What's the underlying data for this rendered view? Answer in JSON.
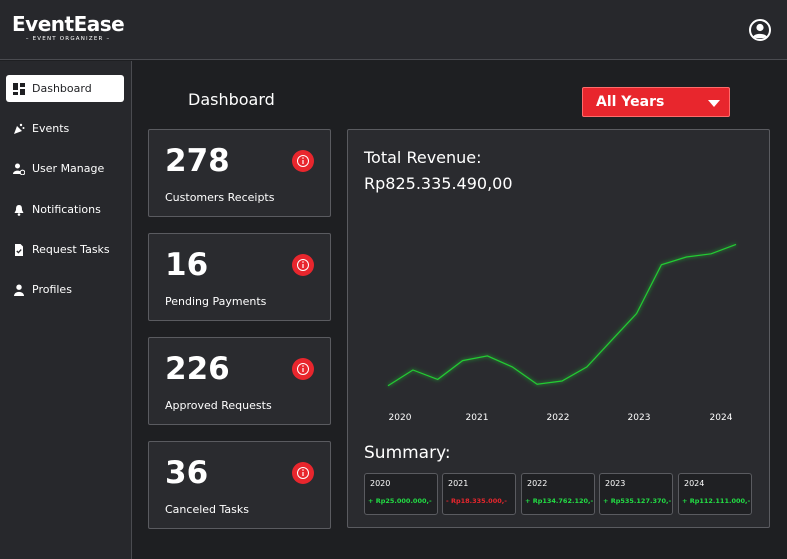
{
  "app": {
    "logo_title": "EventEase",
    "logo_subtitle": "– EVENT ORGANIZER –"
  },
  "header": {
    "profile_icon": "user-circle-icon"
  },
  "sidebar": {
    "items": [
      {
        "label": "Dashboard",
        "icon": "grid-icon",
        "active": true
      },
      {
        "label": "Events",
        "icon": "party-icon"
      },
      {
        "label": "User Manage",
        "icon": "user-gear-icon"
      },
      {
        "label": "Notifications",
        "icon": "bell-icon"
      },
      {
        "label": "Request Tasks",
        "icon": "document-check-icon"
      },
      {
        "label": "Profiles",
        "icon": "person-icon"
      }
    ]
  },
  "main": {
    "title": "Dashboard",
    "year_filter": "All Years",
    "stats": [
      {
        "value": "278",
        "label": "Customers Receipts"
      },
      {
        "value": "16",
        "label": "Pending Payments"
      },
      {
        "value": "226",
        "label": "Approved Requests"
      },
      {
        "value": "36",
        "label": "Canceled Tasks"
      }
    ],
    "revenue": {
      "title": "Total Revenue:",
      "total": "Rp825.335.490,00"
    },
    "summary": {
      "title": "Summary:",
      "items": [
        {
          "year": "2020",
          "value": "+ Rp25.000.000,-",
          "trend": "up"
        },
        {
          "year": "2021",
          "value": "- Rp18.335.000,-",
          "trend": "down"
        },
        {
          "year": "2022",
          "value": "+ Rp134.762.120,-",
          "trend": "up"
        },
        {
          "year": "2023",
          "value": "+ Rp535.127.370,-",
          "trend": "up"
        },
        {
          "year": "2024",
          "value": "+ Rp112.111.000,-",
          "trend": "up"
        }
      ]
    }
  },
  "colors": {
    "accent": "#e8262d",
    "positive": "#22dd44",
    "background": "#1e1f22",
    "panel": "#2a2b2f"
  },
  "chart_data": {
    "type": "line",
    "x": [
      "2020",
      "2021",
      "2022",
      "2023",
      "2024"
    ],
    "series": [
      {
        "values": [
          0.04,
          0.14,
          0.08,
          0.2,
          0.23,
          0.16,
          0.05,
          0.07,
          0.16,
          0.33,
          0.5,
          0.81,
          0.86,
          0.88,
          0.94
        ]
      }
    ],
    "xlabel": "",
    "ylabel": "",
    "grid": false,
    "line_color": "#22cc33"
  }
}
